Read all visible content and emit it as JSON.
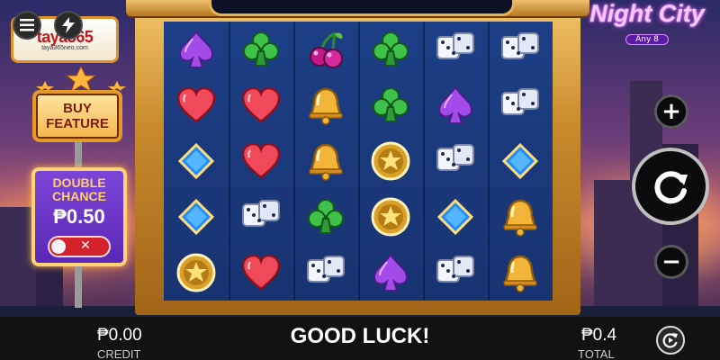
{
  "logo": {
    "main": "taya365",
    "sub": "taya365neo.com"
  },
  "buy_feature": {
    "label": "BUY FEATURE"
  },
  "double_chance": {
    "label": "DOUBLE CHANCE",
    "amount": "₱0.50",
    "enabled": false,
    "off_icon": "x-icon"
  },
  "title": {
    "main": "Night City",
    "badge": "Any 8"
  },
  "controls": {
    "plus_icon": "plus-icon",
    "minus_icon": "minus-icon",
    "spin_icon": "spin-icon",
    "menu_icon": "menu-icon",
    "turbo_icon": "lightning-icon",
    "auto_icon": "autoplay-icon"
  },
  "credit": {
    "value": "₱0.00",
    "label": "CREDIT"
  },
  "status": "GOOD LUCK!",
  "bet": {
    "value": "₱0.4",
    "label": "TOTAL"
  },
  "reels": [
    [
      "spade",
      "heart",
      "diamond",
      "diamond",
      "star"
    ],
    [
      "club",
      "heart",
      "heart",
      "dice",
      "heart"
    ],
    [
      "cherry",
      "bell",
      "bell",
      "club",
      "dice"
    ],
    [
      "club",
      "club",
      "star",
      "star",
      "spade"
    ],
    [
      "dice",
      "spade",
      "dice",
      "diamond",
      "dice"
    ],
    [
      "dice",
      "dice",
      "diamond",
      "bell",
      "bell"
    ]
  ],
  "colors": {
    "frame_gold": "#c88a2c",
    "grid_blue": "#1d3f86",
    "double_chance_purple": "#6a35c8",
    "title_pink": "#f7c6ff"
  }
}
